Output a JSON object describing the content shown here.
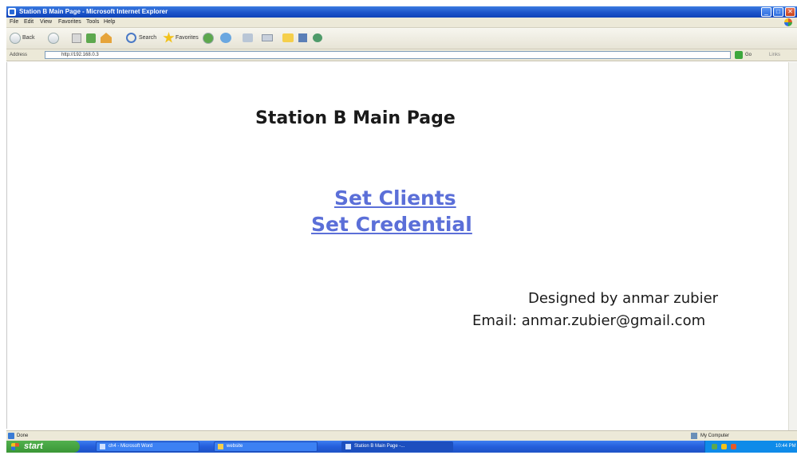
{
  "window": {
    "title": "Station B Main Page - Microsoft Internet Explorer",
    "controls": {
      "minimize": "_",
      "maximize": "□",
      "close": "✕"
    }
  },
  "menubar": {
    "items": [
      "File",
      "Edit",
      "View",
      "Favorites",
      "Tools",
      "Help"
    ]
  },
  "toolbar": {
    "back_label": "Back",
    "search_label": "Search",
    "favorites_label": "Favorites"
  },
  "address_bar": {
    "label": "Address",
    "value": "http://192.168.0.3",
    "go_label": "Go",
    "links_label": "Links"
  },
  "page": {
    "title": "Station B Main Page",
    "links": [
      "Set Clients",
      "Set Credential"
    ],
    "designed_by": "Designed by anmar zubier",
    "email": "Email: anmar.zubier@gmail.com"
  },
  "status_bar": {
    "status": "Done",
    "zone": "My Computer"
  },
  "taskbar": {
    "start_label": "start",
    "tasks": [
      "ch4 - Microsoft Word",
      "website",
      "Station B Main Page -..."
    ],
    "active_task_index": 2,
    "clock": "10:44 PM"
  },
  "colors": {
    "link": "#5b6fd8",
    "titlebar": "#1a52c8",
    "taskbar": "#245edb",
    "start_button": "#3a9636"
  }
}
